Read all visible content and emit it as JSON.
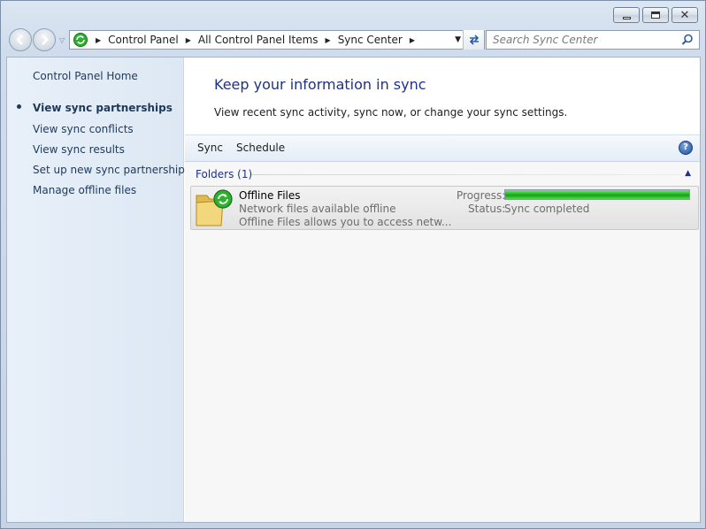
{
  "window": {
    "caption": {
      "minimize": "minimize",
      "maximize": "maximize",
      "close": "close"
    }
  },
  "nav": {
    "breadcrumbs": [
      "Control Panel",
      "All Control Panel Items",
      "Sync Center"
    ],
    "search_placeholder": "Search Sync Center"
  },
  "sidebar": {
    "items": [
      {
        "label": "Control Panel Home",
        "active": false
      },
      {
        "label": "View sync partnerships",
        "active": true
      },
      {
        "label": "View sync conflicts",
        "active": false
      },
      {
        "label": "View sync results",
        "active": false
      },
      {
        "label": "Set up new sync partnerships",
        "active": false
      },
      {
        "label": "Manage offline files",
        "active": false
      }
    ]
  },
  "main": {
    "title": "Keep your information in sync",
    "subtitle": "View recent sync activity, sync now, or change your sync settings.",
    "toolbar": {
      "sync": "Sync",
      "schedule": "Schedule",
      "help": "?"
    },
    "group": {
      "header": "Folders (1)"
    },
    "item": {
      "name": "Offline Files",
      "desc1": "Network files available offline",
      "desc2": "Offline Files allows you to access netw...",
      "progress_label": "Progress:",
      "progress_value": 1.0,
      "status_label": "Status:",
      "status_value": "Sync completed"
    }
  },
  "colors": {
    "title": "#1e3287",
    "link": "#1e395b",
    "progress": "#23b823"
  }
}
